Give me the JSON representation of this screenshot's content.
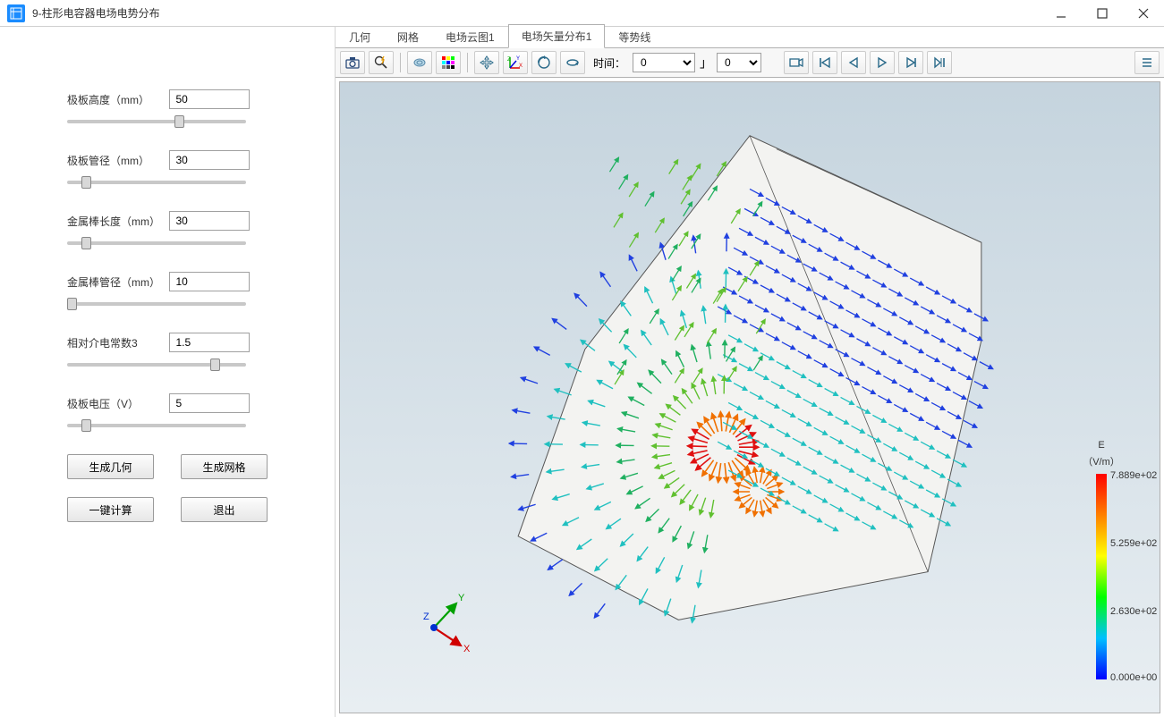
{
  "window": {
    "title": "9-柱形电容器电场电势分布"
  },
  "params": [
    {
      "label": "极板高度（mm）",
      "value": "50",
      "pos": 60
    },
    {
      "label": "极板管径（mm）",
      "value": "30",
      "pos": 8
    },
    {
      "label": "金属棒长度（mm）",
      "value": "30",
      "pos": 8
    },
    {
      "label": "金属棒管径（mm）",
      "value": "10",
      "pos": 0
    },
    {
      "label": "相对介电常数3",
      "value": "1.5",
      "pos": 80
    },
    {
      "label": "极板电压（V）",
      "value": "5",
      "pos": 8
    }
  ],
  "buttons": {
    "gen_geom": "生成几何",
    "gen_mesh": "生成网格",
    "calc": "一键计算",
    "exit": "退出"
  },
  "tabs": [
    {
      "label": "几何",
      "active": false
    },
    {
      "label": "网格",
      "active": false
    },
    {
      "label": "电场云图1",
      "active": false
    },
    {
      "label": "电场矢量分布1",
      "active": true
    },
    {
      "label": "等势线",
      "active": false
    }
  ],
  "toolbar": {
    "icons": [
      "camera-icon",
      "zoom-flash-icon",
      "sep",
      "transparency-icon",
      "color-palette-icon",
      "sep",
      "move-icon",
      "axis-rotate-icon",
      "rotate-xy-icon",
      "rotate-z-icon"
    ],
    "time_label": "时间：",
    "time_value": "0",
    "time_step": "0",
    "play_icons": [
      "video-icon",
      "first-frame-icon",
      "prev-frame-icon",
      "play-icon",
      "next-frame-icon",
      "last-frame-icon"
    ],
    "end_icon": "menu-toggle-icon"
  },
  "legend": {
    "title": "E",
    "unit": "（V/m）",
    "ticks": [
      "7.889e+02",
      "5.259e+02",
      "2.630e+02",
      "0.000e+00"
    ]
  },
  "triad": {
    "x": "X",
    "y": "Y",
    "z": "Z"
  },
  "chart_data": {
    "type": "vector_field",
    "title": "电场矢量分布1",
    "field_name": "E",
    "unit": "V/m",
    "colormap_range": [
      0.0,
      788.9
    ],
    "colormap_ticks": [
      0.0,
      263.0,
      525.9,
      788.9
    ],
    "colormap": "rainbow",
    "description": "3D electric-field vector arrows on a polygonal cut-plane of a cylindrical capacitor; high magnitude (red/orange ~7.9e2 V/m) concentrated at inner conductor edge near center-left, transitioning through yellow/green (~2–5e2) to low-magnitude blue/cyan (~0–2e2) pointing outward toward the outer plate on the right.",
    "geometry_params": {
      "plate_height_mm": 50,
      "plate_diameter_mm": 30,
      "rod_length_mm": 30,
      "rod_diameter_mm": 10,
      "relative_permittivity": 1.5,
      "plate_voltage_V": 5
    }
  }
}
